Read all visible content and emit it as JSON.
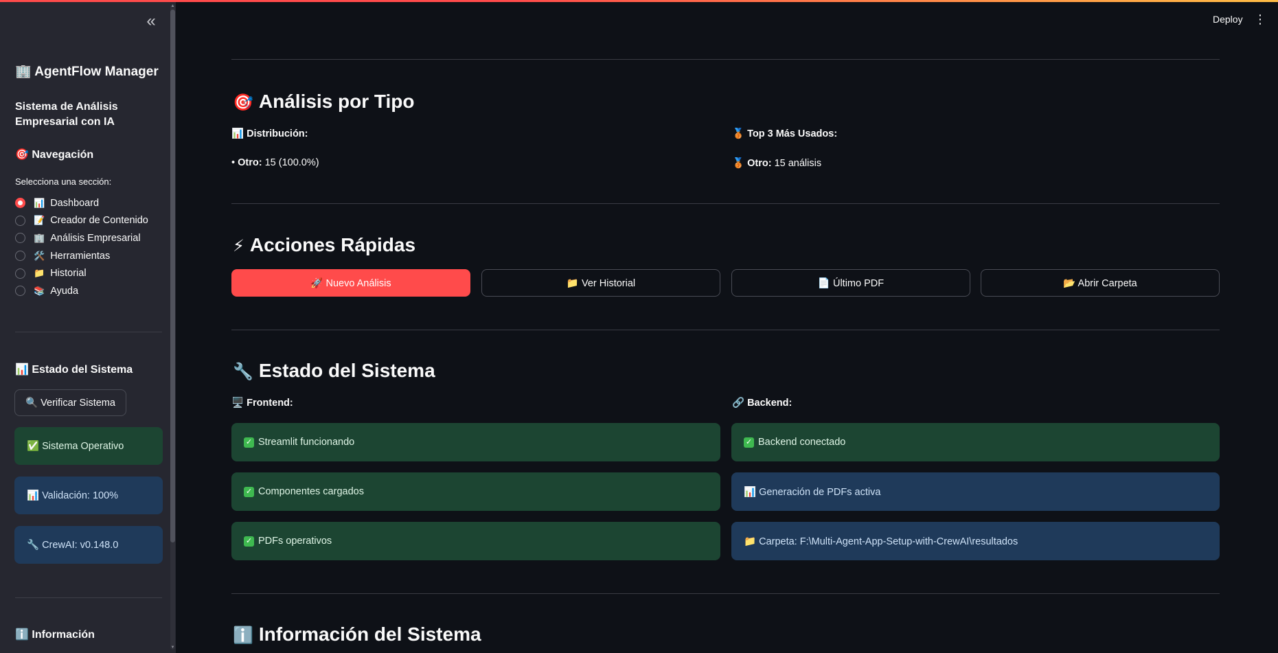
{
  "header": {
    "deploy_label": "Deploy",
    "menu_icon": "⋮"
  },
  "sidebar": {
    "collapse_icon": "«",
    "app_title": "🏢 AgentFlow Manager",
    "subtitle": "Sistema de Análisis Empresarial con IA",
    "nav_title": "🎯 Navegación",
    "nav_label": "Selecciona una sección:",
    "nav_items": [
      {
        "icon": "📊",
        "label": "Dashboard",
        "selected": true
      },
      {
        "icon": "📝",
        "label": "Creador de Contenido",
        "selected": false
      },
      {
        "icon": "🏢",
        "label": "Análisis Empresarial",
        "selected": false
      },
      {
        "icon": "🛠️",
        "label": "Herramientas",
        "selected": false
      },
      {
        "icon": "📁",
        "label": "Historial",
        "selected": false
      },
      {
        "icon": "📚",
        "label": "Ayuda",
        "selected": false
      }
    ],
    "status_title": "📊 Estado del Sistema",
    "verify_button": "🔍 Verificar Sistema",
    "status_ok": "✅ Sistema Operativo",
    "validation": "📊 Validación: 100%",
    "crewai": "🔧 CrewAI: v0.148.0",
    "info_title": "ℹ️ Información"
  },
  "main": {
    "analysis": {
      "title": "Análisis por Tipo",
      "title_icon": "🎯",
      "dist_label": "📊 Distribución:",
      "dist_item_bullet": "•",
      "dist_item_name": "Otro:",
      "dist_item_value": "15 (100.0%)",
      "top_label": "🥉 Top 3 Más Usados:",
      "top_item_icon": "🥉",
      "top_item_name": "Otro:",
      "top_item_value": "15 análisis"
    },
    "actions": {
      "title": "Acciones Rápidas",
      "title_icon": "⚡",
      "buttons": [
        "🚀 Nuevo Análisis",
        "📁 Ver Historial",
        "📄 Último PDF",
        "📂 Abrir Carpeta"
      ]
    },
    "system": {
      "title": "Estado del Sistema",
      "title_icon": "🔧",
      "frontend_label": "🖥️ Frontend:",
      "backend_label": "🔗 Backend:",
      "frontend": [
        "Streamlit funcionando",
        "Componentes cargados",
        "PDFs operativos"
      ],
      "backend": [
        "Backend conectado",
        "📊 Generación de PDFs activa",
        "📁 Carpeta: F:\\Multi-Agent-App-Setup-with-CrewAI\\resultados"
      ]
    },
    "info": {
      "title": "Información del Sistema",
      "title_icon": "ℹ️"
    }
  },
  "colors": {
    "primary": "#ff4b4b",
    "success_bg": "#1c4532",
    "info_bg": "#1f3a5a",
    "background": "#0e1117",
    "sidebar_bg": "#262730"
  }
}
